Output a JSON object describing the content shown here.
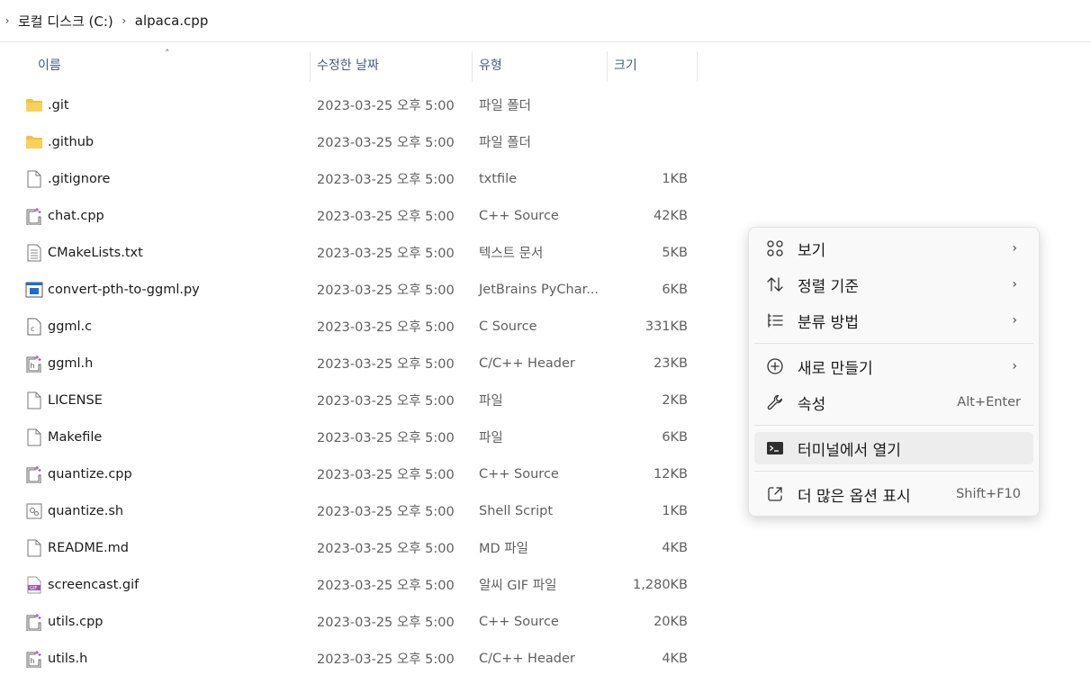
{
  "breadcrumb": {
    "items": [
      "로컬 디스크 (C:)",
      "alpaca.cpp"
    ]
  },
  "columns": {
    "name": "이름",
    "date": "수정한 날짜",
    "type": "유형",
    "size": "크기"
  },
  "files": [
    {
      "name": ".git",
      "date": "2023-03-25 오후 5:00",
      "type": "파일 폴더",
      "size": "",
      "icon": "folder-icon"
    },
    {
      "name": ".github",
      "date": "2023-03-25 오후 5:00",
      "type": "파일 폴더",
      "size": "",
      "icon": "folder-icon"
    },
    {
      "name": ".gitignore",
      "date": "2023-03-25 오후 5:00",
      "type": "txtfile",
      "size": "1KB",
      "icon": "file-icon"
    },
    {
      "name": "chat.cpp",
      "date": "2023-03-25 오후 5:00",
      "type": "C++ Source",
      "size": "42KB",
      "icon": "cpp-file-icon"
    },
    {
      "name": "CMakeLists.txt",
      "date": "2023-03-25 오후 5:00",
      "type": "텍스트 문서",
      "size": "5KB",
      "icon": "text-file-icon"
    },
    {
      "name": "convert-pth-to-ggml.py",
      "date": "2023-03-25 오후 5:00",
      "type": "JetBrains PyChar...",
      "size": "6KB",
      "icon": "python-file-icon"
    },
    {
      "name": "ggml.c",
      "date": "2023-03-25 오후 5:00",
      "type": "C Source",
      "size": "331KB",
      "icon": "c-file-icon"
    },
    {
      "name": "ggml.h",
      "date": "2023-03-25 오후 5:00",
      "type": "C/C++ Header",
      "size": "23KB",
      "icon": "header-file-icon"
    },
    {
      "name": "LICENSE",
      "date": "2023-03-25 오후 5:00",
      "type": "파일",
      "size": "2KB",
      "icon": "file-icon"
    },
    {
      "name": "Makefile",
      "date": "2023-03-25 오후 5:00",
      "type": "파일",
      "size": "6KB",
      "icon": "file-icon"
    },
    {
      "name": "quantize.cpp",
      "date": "2023-03-25 오후 5:00",
      "type": "C++ Source",
      "size": "12KB",
      "icon": "cpp-file-icon"
    },
    {
      "name": "quantize.sh",
      "date": "2023-03-25 오후 5:00",
      "type": "Shell Script",
      "size": "1KB",
      "icon": "script-file-icon"
    },
    {
      "name": "README.md",
      "date": "2023-03-25 오후 5:00",
      "type": "MD 파일",
      "size": "4KB",
      "icon": "file-icon"
    },
    {
      "name": "screencast.gif",
      "date": "2023-03-25 오후 5:00",
      "type": "알씨 GIF 파일",
      "size": "1,280KB",
      "icon": "gif-file-icon"
    },
    {
      "name": "utils.cpp",
      "date": "2023-03-25 오후 5:00",
      "type": "C++ Source",
      "size": "20KB",
      "icon": "cpp-file-icon"
    },
    {
      "name": "utils.h",
      "date": "2023-03-25 오후 5:00",
      "type": "C/C++ Header",
      "size": "4KB",
      "icon": "header-file-icon"
    }
  ],
  "context_menu": {
    "view": "보기",
    "sort": "정렬 기준",
    "group": "분류 방법",
    "new": "새로 만들기",
    "properties": "속성",
    "properties_shortcut": "Alt+Enter",
    "open_terminal": "터미널에서 열기",
    "more_options": "더 많은 옵션 표시",
    "more_options_shortcut": "Shift+F10"
  },
  "colors": {
    "folder": "#f3c13a",
    "accent": "#2b6fc2",
    "gif": "#9b59b6"
  }
}
